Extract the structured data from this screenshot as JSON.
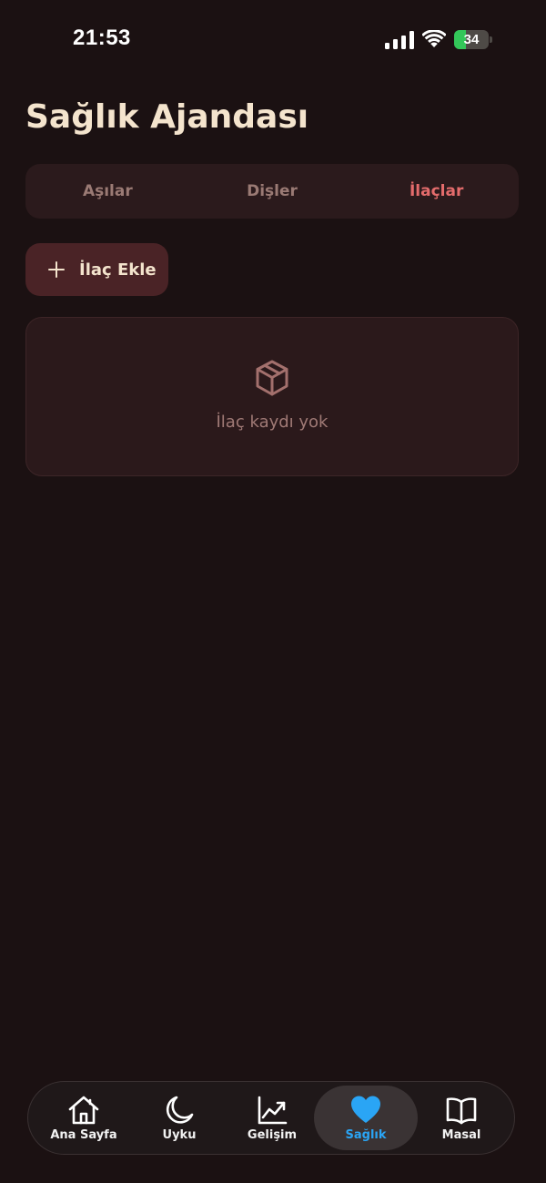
{
  "status_bar": {
    "time": "21:53",
    "battery_percent": 34,
    "battery_label": "34",
    "icons": [
      "cellular-signal-icon",
      "wifi-icon",
      "battery-charging-icon"
    ]
  },
  "page": {
    "title": "Sağlık Ajandası"
  },
  "segments": {
    "tabs": [
      {
        "label": "Aşılar",
        "selected": false
      },
      {
        "label": "Dişler",
        "selected": false
      },
      {
        "label": "İlaçlar",
        "selected": true
      }
    ]
  },
  "actions": {
    "add_label": "İlaç Ekle",
    "add_icon": "plus-icon"
  },
  "empty_state": {
    "icon": "box-icon",
    "message": "İlaç kaydı yok"
  },
  "tabbar": {
    "items": [
      {
        "label": "Ana Sayfa",
        "icon": "home-icon",
        "selected": false
      },
      {
        "label": "Uyku",
        "icon": "moon-icon",
        "selected": false
      },
      {
        "label": "Gelişim",
        "icon": "chart-trend-icon",
        "selected": false
      },
      {
        "label": "Sağlık",
        "icon": "heart-icon",
        "selected": true
      },
      {
        "label": "Masal",
        "icon": "book-icon",
        "selected": false
      }
    ]
  },
  "colors": {
    "background": "#1b1112",
    "title": "#f4e4cd",
    "accent_selected_segment": "#e46c6c",
    "accent_selected_tab": "#2aa5f5",
    "battery_green": "#33c759"
  }
}
